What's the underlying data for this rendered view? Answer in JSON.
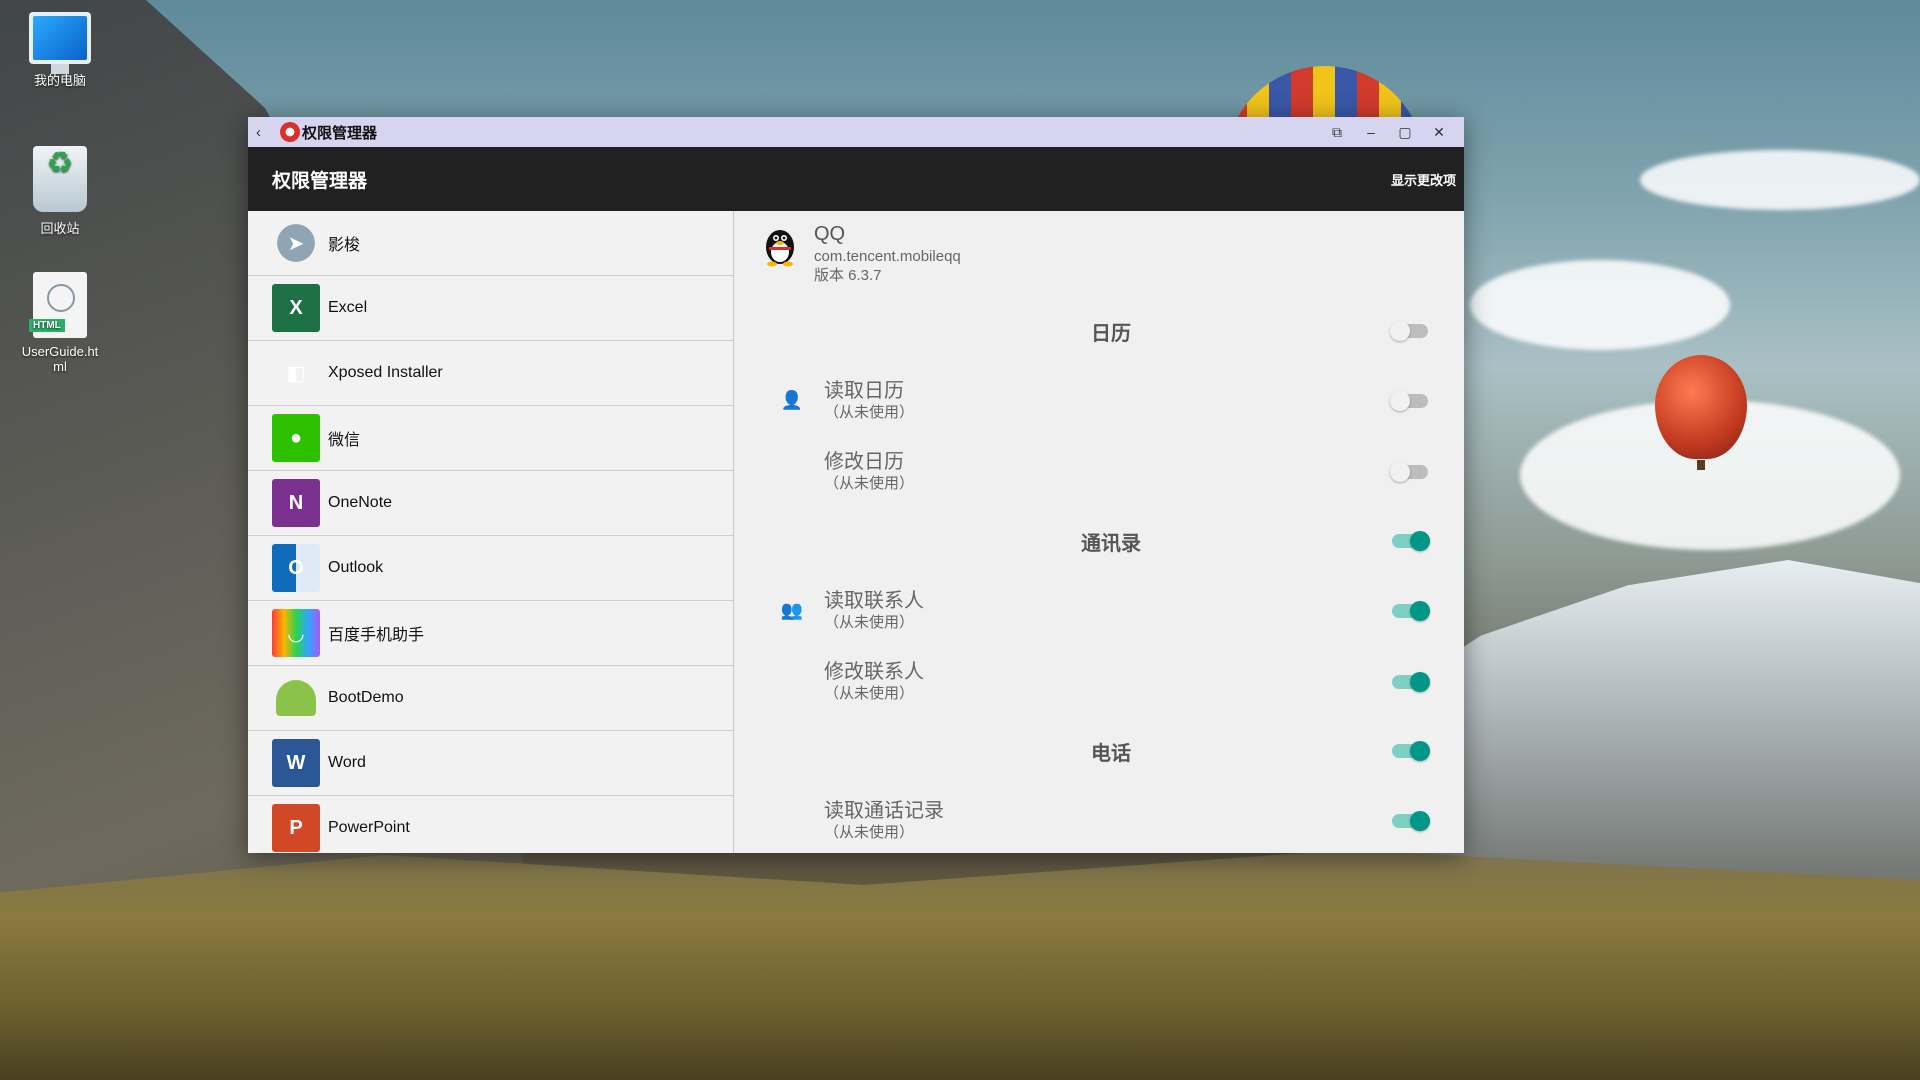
{
  "desktop": {
    "icons": [
      {
        "label": "我的电脑"
      },
      {
        "label": "回收站"
      },
      {
        "label": "UserGuide.html"
      }
    ]
  },
  "window": {
    "title": "权限管理器",
    "titlebar_buttons": [
      "back-icon",
      "pin-icon",
      "minimize-icon",
      "maximize-icon",
      "close-icon"
    ]
  },
  "actionbar": {
    "title": "权限管理器",
    "action": "显示更改项"
  },
  "apps": [
    {
      "label": "影梭",
      "icon": "yingsuo-icon"
    },
    {
      "label": "Excel",
      "icon": "excel-icon"
    },
    {
      "label": "Xposed Installer",
      "icon": "xposed-icon"
    },
    {
      "label": "微信",
      "icon": "wechat-icon"
    },
    {
      "label": "OneNote",
      "icon": "onenote-icon"
    },
    {
      "label": "Outlook",
      "icon": "outlook-icon"
    },
    {
      "label": "百度手机助手",
      "icon": "baidu-icon"
    },
    {
      "label": "BootDemo",
      "icon": "android-icon"
    },
    {
      "label": "Word",
      "icon": "word-icon"
    },
    {
      "label": "PowerPoint",
      "icon": "powerpoint-icon"
    }
  ],
  "detail": {
    "app_name": "QQ",
    "package": "com.tencent.mobileqq",
    "version": "版本 6.3.7",
    "groups": [
      {
        "title": "日历",
        "enabled": false,
        "perms": [
          {
            "name": "读取日历",
            "status": "（从未使用）",
            "enabled": false,
            "icon": "person-icon"
          },
          {
            "name": "修改日历",
            "status": "（从未使用）",
            "enabled": false,
            "icon": ""
          }
        ]
      },
      {
        "title": "通讯录",
        "enabled": true,
        "perms": [
          {
            "name": "读取联系人",
            "status": "（从未使用）",
            "enabled": true,
            "icon": "people-icon"
          },
          {
            "name": "修改联系人",
            "status": "（从未使用）",
            "enabled": true,
            "icon": ""
          }
        ]
      },
      {
        "title": "电话",
        "enabled": true,
        "perms": [
          {
            "name": "读取通话记录",
            "status": "（从未使用）",
            "enabled": true,
            "icon": ""
          }
        ]
      }
    ]
  },
  "colors": {
    "toggle_on": "#009688",
    "actionbar_bg": "#212121",
    "titlebar_bg": "#d6d4ef"
  }
}
